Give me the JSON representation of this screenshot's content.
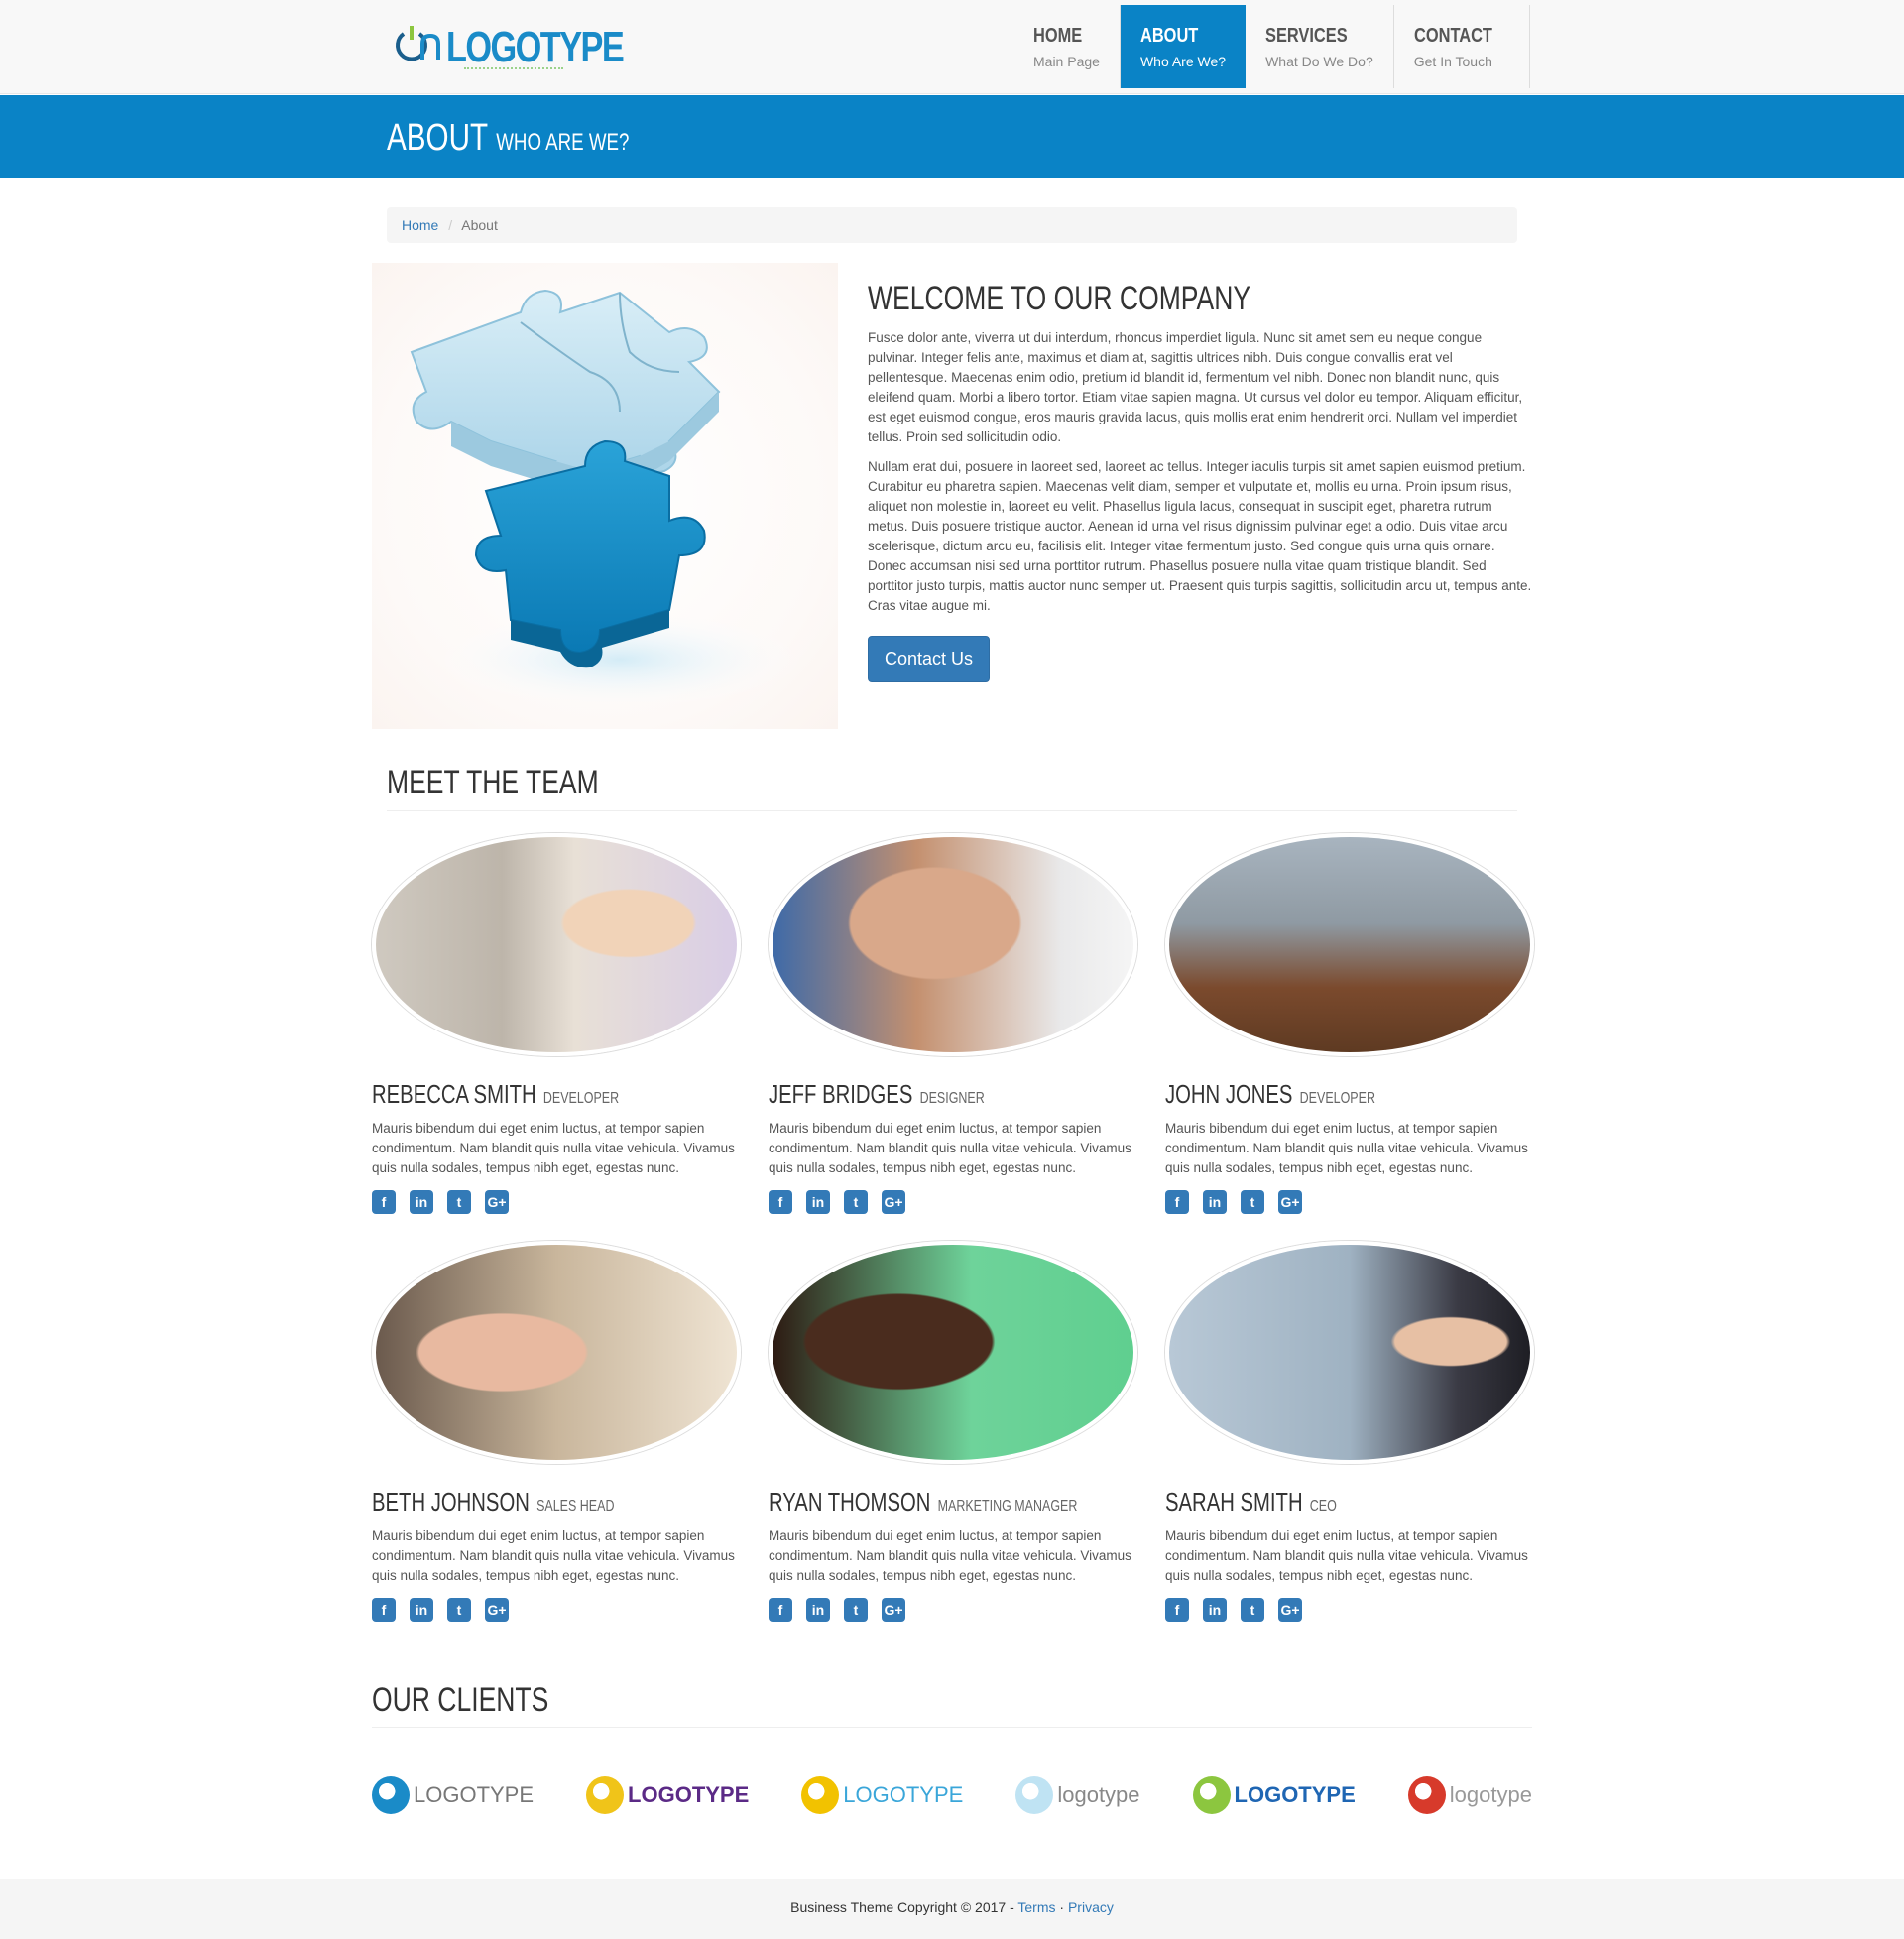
{
  "brand": {
    "logo_text": "LOGOTYPE"
  },
  "nav": [
    {
      "title": "HOME",
      "subtitle": "Main Page",
      "active": false
    },
    {
      "title": "ABOUT",
      "subtitle": "Who Are We?",
      "active": true
    },
    {
      "title": "SERVICES",
      "subtitle": "What Do We Do?",
      "active": false
    },
    {
      "title": "CONTACT",
      "subtitle": "Get In Touch",
      "active": false
    }
  ],
  "page_header": {
    "title": "ABOUT",
    "subtitle": "WHO ARE WE?"
  },
  "breadcrumb": {
    "home": "Home",
    "separator": "/",
    "current": "About"
  },
  "about": {
    "heading": "WELCOME TO OUR COMPANY",
    "paragraph1": "Fusce dolor ante, viverra ut dui interdum, rhoncus imperdiet ligula. Nunc sit amet sem eu neque congue pulvinar. Integer felis ante, maximus et diam at, sagittis ultrices nibh. Duis congue convallis erat vel pellentesque. Maecenas enim odio, pretium id blandit id, fermentum vel nibh. Donec non blandit nunc, quis eleifend quam. Morbi a libero tortor. Etiam vitae sapien magna. Ut cursus vel dolor eu tempor. Aliquam efficitur, est eget euismod congue, eros mauris gravida lacus, quis mollis erat enim hendrerit orci. Nullam vel imperdiet tellus. Proin sed sollicitudin odio.",
    "paragraph2": "Nullam erat dui, posuere in laoreet sed, laoreet ac tellus. Integer iaculis turpis sit amet sapien euismod pretium. Curabitur eu pharetra sapien. Maecenas velit diam, semper et vulputate et, mollis eu urna. Proin ipsum risus, aliquet non molestie in, laoreet eu velit. Phasellus ligula lacus, consequat in suscipit eget, pharetra rutrum metus. Duis posuere tristique auctor. Aenean id urna vel risus dignissim pulvinar eget a odio. Duis vitae arcu scelerisque, dictum arcu eu, facilisis elit. Integer vitae fermentum justo. Sed congue quis urna quis ornare. Donec accumsan nisi sed urna porttitor rutrum. Phasellus posuere nulla vitae quam tristique blandit. Sed porttitor justo turpis, mattis auctor nunc semper ut. Praesent quis turpis sagittis, sollicitudin arcu ut, tempus ante. Cras vitae augue mi.",
    "button": "Contact Us"
  },
  "team": {
    "heading": "MEET THE TEAM",
    "members": [
      {
        "name": "REBECCA SMITH",
        "role": "DEVELOPER",
        "bio": "Mauris bibendum dui eget enim luctus, at tempor sapien condimentum. Nam blandit quis nulla vitae vehicula. Vivamus quis nulla sodales, tempus nibh eget, egestas nunc."
      },
      {
        "name": "JEFF BRIDGES",
        "role": "DESIGNER",
        "bio": "Mauris bibendum dui eget enim luctus, at tempor sapien condimentum. Nam blandit quis nulla vitae vehicula. Vivamus quis nulla sodales, tempus nibh eget, egestas nunc."
      },
      {
        "name": "JOHN JONES",
        "role": "DEVELOPER",
        "bio": "Mauris bibendum dui eget enim luctus, at tempor sapien condimentum. Nam blandit quis nulla vitae vehicula. Vivamus quis nulla sodales, tempus nibh eget, egestas nunc."
      },
      {
        "name": "BETH JOHNSON",
        "role": "SALES HEAD",
        "bio": "Mauris bibendum dui eget enim luctus, at tempor sapien condimentum. Nam blandit quis nulla vitae vehicula. Vivamus quis nulla sodales, tempus nibh eget, egestas nunc."
      },
      {
        "name": "RYAN THOMSON",
        "role": "MARKETING MANAGER",
        "bio": "Mauris bibendum dui eget enim luctus, at tempor sapien condimentum. Nam blandit quis nulla vitae vehicula. Vivamus quis nulla sodales, tempus nibh eget, egestas nunc."
      },
      {
        "name": "SARAH SMITH",
        "role": "CEO",
        "bio": "Mauris bibendum dui eget enim luctus, at tempor sapien condimentum. Nam blandit quis nulla vitae vehicula. Vivamus quis nulla sodales, tempus nibh eget, egestas nunc."
      }
    ],
    "social_icons": [
      "facebook-icon",
      "linkedin-icon",
      "twitter-icon",
      "google-plus-icon"
    ],
    "social_glyphs": [
      "f",
      "in",
      "t",
      "G+"
    ]
  },
  "clients": {
    "heading": "OUR CLIENTS",
    "logos": [
      {
        "text": "LOGOTYPE",
        "color": "#777777",
        "mark": "#1a8bc8"
      },
      {
        "text": "LOGOTYPE",
        "color": "#5b2a86",
        "mark": "#f0c419"
      },
      {
        "text": "LOGOTYPE",
        "color": "#3aa6d9",
        "mark": "#f2c200"
      },
      {
        "text": "logotype",
        "color": "#888888",
        "mark": "#bfe3f3"
      },
      {
        "text": "LOGOTYPE",
        "color": "#1f66b3",
        "mark": "#8cc63f"
      },
      {
        "text": "logotype",
        "color": "#999999",
        "mark": "#d73a2b"
      }
    ]
  },
  "footer": {
    "copyright": "Business Theme Copyright © 2017 -",
    "terms": "Terms",
    "dot": "·",
    "privacy": "Privacy"
  },
  "colors": {
    "primary": "#0a83c6",
    "link": "#337ab7"
  }
}
